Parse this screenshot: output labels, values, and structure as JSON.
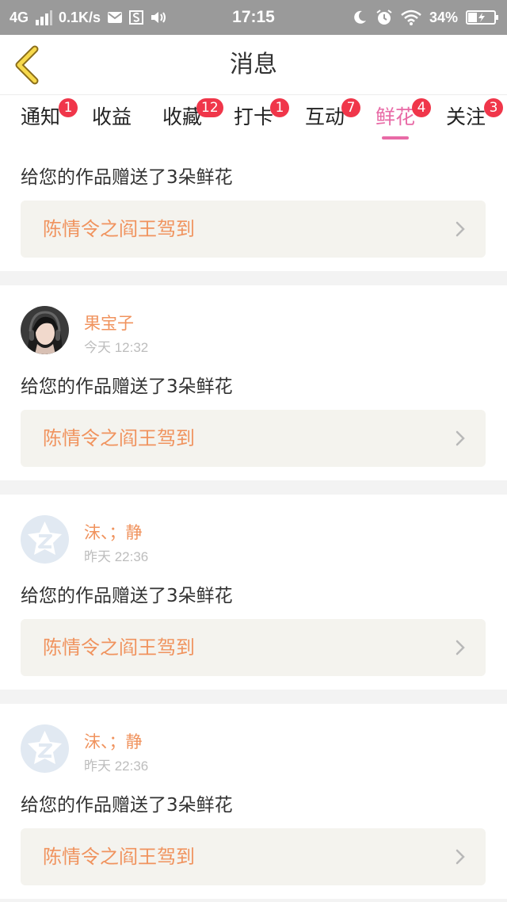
{
  "status_bar": {
    "network": "4G",
    "speed": "0.1K/s",
    "time": "17:15",
    "battery": "34%"
  },
  "header": {
    "title": "消息"
  },
  "tabs": [
    {
      "label": "通知",
      "badge": "1",
      "active": false
    },
    {
      "label": "收益",
      "badge": "",
      "active": false
    },
    {
      "label": "收藏",
      "badge": "12",
      "active": false
    },
    {
      "label": "打卡",
      "badge": "1",
      "active": false
    },
    {
      "label": "互动",
      "badge": "7",
      "active": false
    },
    {
      "label": "鲜花",
      "badge": "4",
      "active": true
    },
    {
      "label": "关注",
      "badge": "3",
      "active": false
    }
  ],
  "messages": [
    {
      "user": "",
      "time": "",
      "text": "给您的作品赠送了3朵鲜花",
      "work": "陈情令之阎王驾到"
    },
    {
      "user": "果宝子",
      "time": "今天 12:32",
      "text": "给您的作品赠送了3朵鲜花",
      "work": "陈情令之阎王驾到",
      "avatar": "photo-avatar"
    },
    {
      "user": "沫、；静",
      "time": "昨天 22:36",
      "text": "给您的作品赠送了3朵鲜花",
      "work": "陈情令之阎王驾到",
      "avatar": "default-qq-avatar"
    },
    {
      "user": "沫、；静",
      "time": "昨天 22:36",
      "text": "给您的作品赠送了3朵鲜花",
      "work": "陈情令之阎王驾到",
      "avatar": "default-qq-avatar"
    }
  ],
  "colors": {
    "accent": "#e86aa6",
    "badge": "#f0364a",
    "name": "#f0935e",
    "status_bar": "#9a9a9a"
  }
}
